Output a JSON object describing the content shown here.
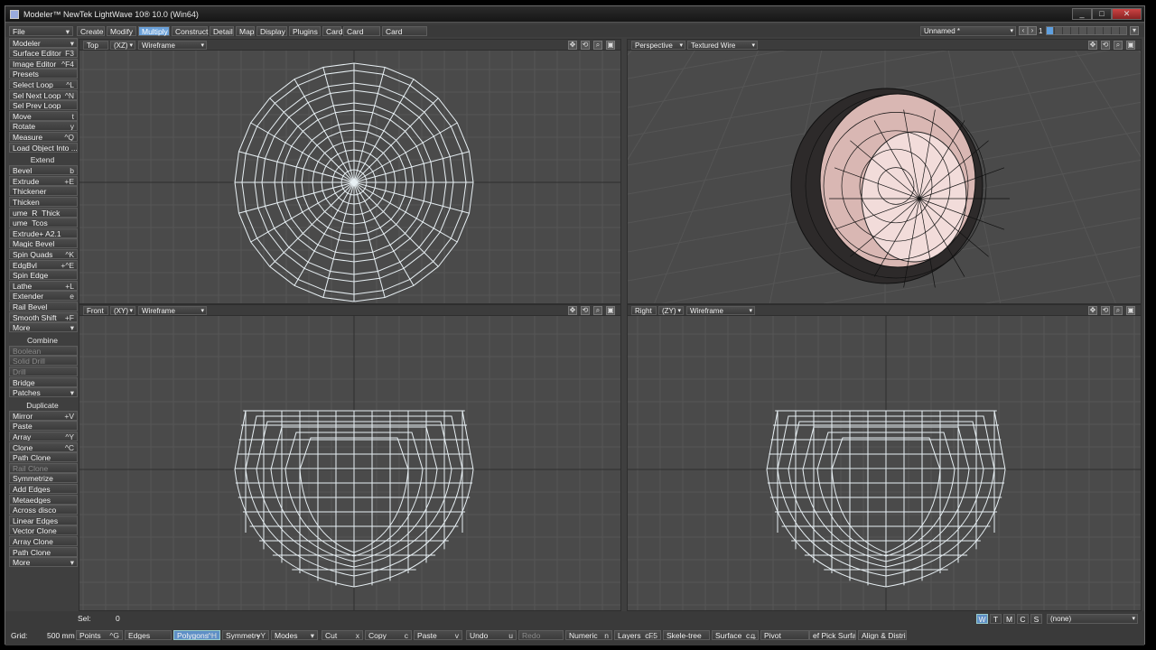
{
  "window": {
    "title": "Modeler™ NewTek LightWave 10® 10.0 (Win64)",
    "buttons": [
      "_",
      "□",
      "✕"
    ]
  },
  "menu": {
    "file": "File",
    "tabs": [
      "Create",
      "Modify",
      "Multiply",
      "Construct",
      "Detail",
      "Map",
      "Display",
      "Plugins",
      "Card",
      "Card Edit",
      "Card Options"
    ],
    "active_tab": "Multiply",
    "object": "Unnamed *",
    "layer": "1"
  },
  "sidebar": {
    "top": [
      {
        "l": "Modeler",
        "s": "▾"
      },
      {
        "l": "Surface Editor",
        "s": "F3"
      },
      {
        "l": "Image Editor",
        "s": "^F4"
      },
      {
        "l": "Presets",
        "s": ""
      },
      {
        "l": "Select Loop",
        "s": "^L"
      },
      {
        "l": "Sel Next Loop",
        "s": "^N"
      },
      {
        "l": "Sel Prev Loop",
        "s": ""
      },
      {
        "l": "Move",
        "s": "t"
      },
      {
        "l": "Rotate",
        "s": "y"
      },
      {
        "l": "Measure",
        "s": "^Q"
      },
      {
        "l": "Load Object Into ...",
        "s": ""
      }
    ],
    "extend_header": "Extend",
    "extend": [
      {
        "l": "Bevel",
        "s": "b"
      },
      {
        "l": "Extrude",
        "s": "+E"
      },
      {
        "l": "Thickener",
        "s": ""
      },
      {
        "l": "Thicken",
        "s": ""
      },
      {
        "l": "ume_R_Thick",
        "s": ""
      },
      {
        "l": "ume_Tcos",
        "s": ""
      },
      {
        "l": "Extrude+ A2.1",
        "s": ""
      },
      {
        "l": "Magic Bevel",
        "s": ""
      },
      {
        "l": "Spin Quads",
        "s": "^K"
      },
      {
        "l": "EdgBvl",
        "s": "+^E"
      },
      {
        "l": "Spin Edge",
        "s": ""
      },
      {
        "l": "Lathe",
        "s": "+L"
      },
      {
        "l": "Extender",
        "s": "e"
      },
      {
        "l": "Rail Bevel",
        "s": ""
      },
      {
        "l": "Smooth Shift",
        "s": "+F"
      },
      {
        "l": "More",
        "s": "▾"
      }
    ],
    "combine_header": "Combine",
    "combine": [
      {
        "l": "Boolean",
        "s": "",
        "d": true
      },
      {
        "l": "Solid Drill",
        "s": "",
        "d": true
      },
      {
        "l": "Drill",
        "s": "",
        "d": true
      },
      {
        "l": "Bridge",
        "s": ""
      },
      {
        "l": "Patches",
        "s": "▾"
      }
    ],
    "duplicate_header": "Duplicate",
    "duplicate": [
      {
        "l": "Mirror",
        "s": "+V"
      },
      {
        "l": "Paste",
        "s": ""
      },
      {
        "l": "Array",
        "s": "^Y"
      },
      {
        "l": "Clone",
        "s": "^C"
      },
      {
        "l": "Path Clone",
        "s": ""
      },
      {
        "l": "Rail Clone",
        "s": "",
        "d": true
      },
      {
        "l": "Symmetrize",
        "s": ""
      },
      {
        "l": "Add Edges",
        "s": ""
      },
      {
        "l": "Metaedges",
        "s": ""
      },
      {
        "l": "Across disco",
        "s": ""
      },
      {
        "l": "Linear Edges",
        "s": ""
      },
      {
        "l": "Vector Clone",
        "s": ""
      },
      {
        "l": "Array Clone",
        "s": ""
      },
      {
        "l": "Path Clone",
        "s": ""
      },
      {
        "l": "More",
        "s": "▾"
      }
    ]
  },
  "viewports": {
    "tl": {
      "view": "Top",
      "axes": "(XZ)",
      "mode": "Wireframe"
    },
    "tr": {
      "view": "Perspective",
      "mode": "Textured Wire"
    },
    "bl": {
      "view": "Front",
      "axes": "(XY)",
      "mode": "Wireframe"
    },
    "br": {
      "view": "Right",
      "axes": "(ZY)",
      "mode": "Wireframe"
    }
  },
  "status": {
    "sel_label": "Sel:",
    "sel_value": "0",
    "grid_label": "Grid:",
    "grid_value": "500 mm",
    "wtmcs": [
      "W",
      "T",
      "M",
      "C",
      "S"
    ],
    "surface": "(none)"
  },
  "bottom": [
    {
      "l": "Points",
      "s": "^G"
    },
    {
      "l": "Edges",
      "s": ""
    },
    {
      "l": "Polygons",
      "s": "^H",
      "a": true
    },
    {
      "l": "Symmetry",
      "s": "+Y"
    },
    {
      "l": "Modes",
      "s": "▾"
    },
    {
      "l": "Cut",
      "s": "x"
    },
    {
      "l": "Copy",
      "s": "c"
    },
    {
      "l": "Paste",
      "s": "v"
    },
    {
      "l": "Undo",
      "s": "u"
    },
    {
      "l": "Redo",
      "s": "",
      "d": true
    },
    {
      "l": "Numeric",
      "s": "n"
    },
    {
      "l": "Layers_c...",
      "s": "F5"
    },
    {
      "l": "Skele-tree",
      "s": ""
    },
    {
      "l": "Surface_c...",
      "s": "q"
    },
    {
      "l": "Pivot",
      "s": ""
    },
    {
      "l": "ef Pick Surfa...",
      "s": ""
    },
    {
      "l": "Align & Distri...",
      "s": ""
    }
  ]
}
